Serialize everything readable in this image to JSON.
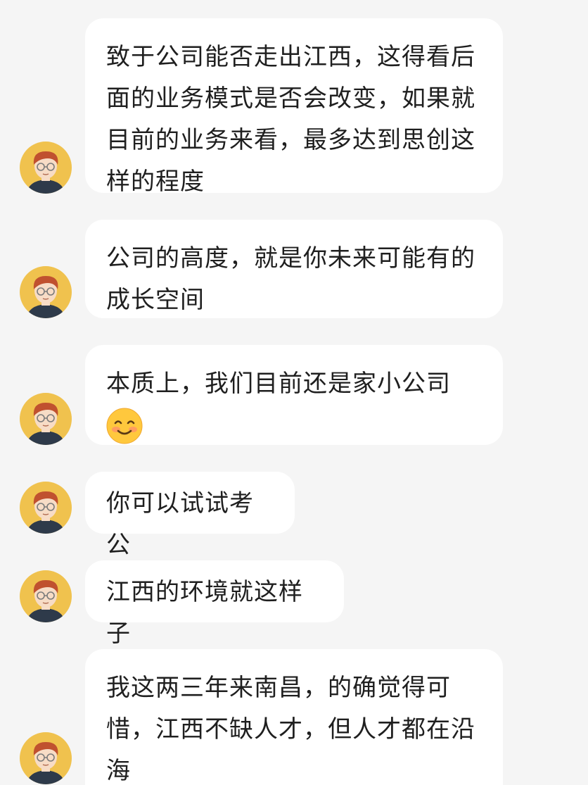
{
  "colors": {
    "background": "#f5f5f5",
    "bubble": "#ffffff",
    "text": "#1f1f1f",
    "avatar_bg": "#f0c24e",
    "hair": "#c0512f",
    "skin": "#f7dcc6",
    "shirt": "#2e3a4a"
  },
  "messages": [
    {
      "sender": "other",
      "avatar_icon": "avatar-cartoon-man-glasses",
      "lines": [
        "致于公司能否走出江西，这得看后",
        "面的业务模式是否会改变，如果就",
        "目前的业务来看，最多达到思创这",
        "样的程度"
      ]
    },
    {
      "sender": "other",
      "avatar_icon": "avatar-cartoon-man-glasses",
      "lines": [
        "公司的高度，就是你未来可能有的",
        "成长空间"
      ]
    },
    {
      "sender": "other",
      "avatar_icon": "avatar-cartoon-man-glasses",
      "lines": [
        "本质上，我们目前还是家小公司"
      ],
      "emoji": "smiling-face-emoji"
    },
    {
      "sender": "other",
      "avatar_icon": "avatar-cartoon-man-glasses",
      "lines": [
        "你可以试试考公"
      ]
    },
    {
      "sender": "other",
      "avatar_icon": "avatar-cartoon-man-glasses",
      "lines": [
        "江西的环境就这样子"
      ]
    },
    {
      "sender": "other",
      "avatar_icon": "avatar-cartoon-man-glasses",
      "lines": [
        "我这两三年来南昌，的确觉得可",
        "惜，江西不缺人才，但人才都在沿",
        "海"
      ]
    }
  ]
}
